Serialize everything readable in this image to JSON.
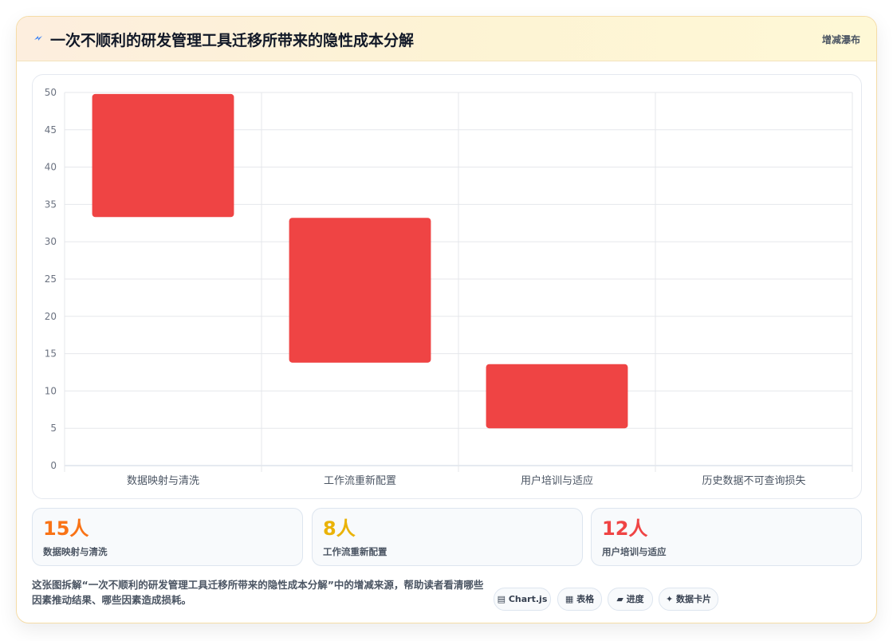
{
  "header": {
    "icon": "lightning-icon",
    "title": "一次不顺利的研发管理工具迁移所带来的隐性成本分解",
    "tag": "增减瀑布"
  },
  "colors": {
    "bar": "#ef4444",
    "stat1": "#f97316",
    "stat2": "#eab308",
    "stat3": "#ef4444"
  },
  "chart_data": {
    "type": "bar",
    "subtype": "waterfall",
    "categories": [
      "数据映射与清洗",
      "工作流重新配置",
      "用户培训与适应",
      "历史数据不可查询损失"
    ],
    "ranges": [
      [
        33.3,
        49.8
      ],
      [
        13.8,
        33.2
      ],
      [
        5.0,
        13.6
      ],
      null
    ],
    "ylim": [
      0,
      50
    ],
    "yticks": [
      0,
      5,
      10,
      15,
      20,
      25,
      30,
      35,
      40,
      45,
      50
    ],
    "grid": true,
    "legend": "none"
  },
  "stats": [
    {
      "value": "15人",
      "label": "数据映射与清洗"
    },
    {
      "value": "8人",
      "label": "工作流重新配置"
    },
    {
      "value": "12人",
      "label": "用户培训与适应"
    }
  ],
  "footer": {
    "text": "这张图拆解“一次不顺利的研发管理工具迁移所带来的隐性成本分解”中的增减来源，帮助读者看清哪些因素推动结果、哪些因素造成损耗。",
    "pills": [
      {
        "icon": "chart-icon",
        "label": "Chart.js"
      },
      {
        "icon": "table-icon",
        "label": "表格"
      },
      {
        "icon": "progress-icon",
        "label": "进度"
      },
      {
        "icon": "sparkle-icon",
        "label": "数据卡片"
      }
    ]
  }
}
